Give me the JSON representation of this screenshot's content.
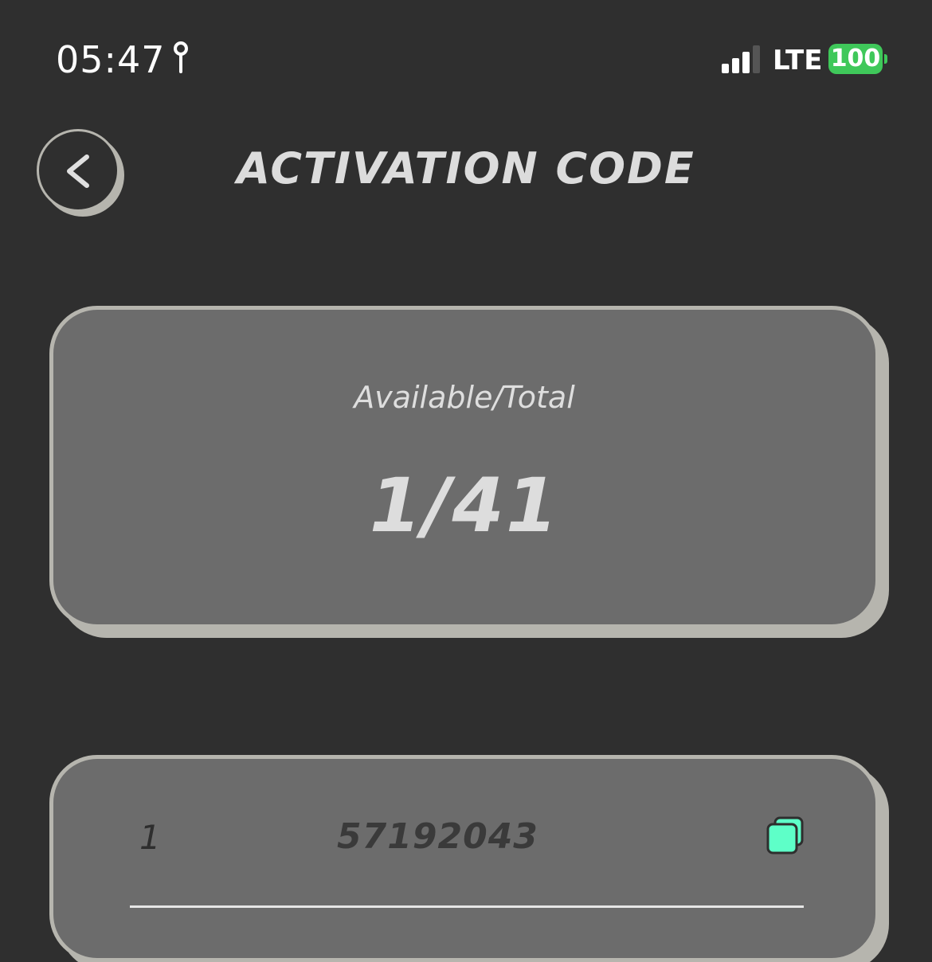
{
  "status_bar": {
    "time": "05:47",
    "network": "LTE",
    "battery": "100",
    "signal_bars": 3,
    "battery_color": "#3fc85a",
    "icons": [
      "location-icon",
      "signal-icon",
      "battery-icon"
    ]
  },
  "header": {
    "title": "ACTIVATION CODE",
    "back_icon": "chevron-left-icon"
  },
  "summary": {
    "label": "Available/Total",
    "value": "1/41"
  },
  "codes": [
    {
      "index": "1",
      "code": "57192043",
      "copy_icon": "copy-icon"
    }
  ],
  "colors": {
    "background": "#2f2f2f",
    "card": "#6c6c6c",
    "card_border": "#b6b5ae",
    "copy_accent": "#5effc8"
  }
}
